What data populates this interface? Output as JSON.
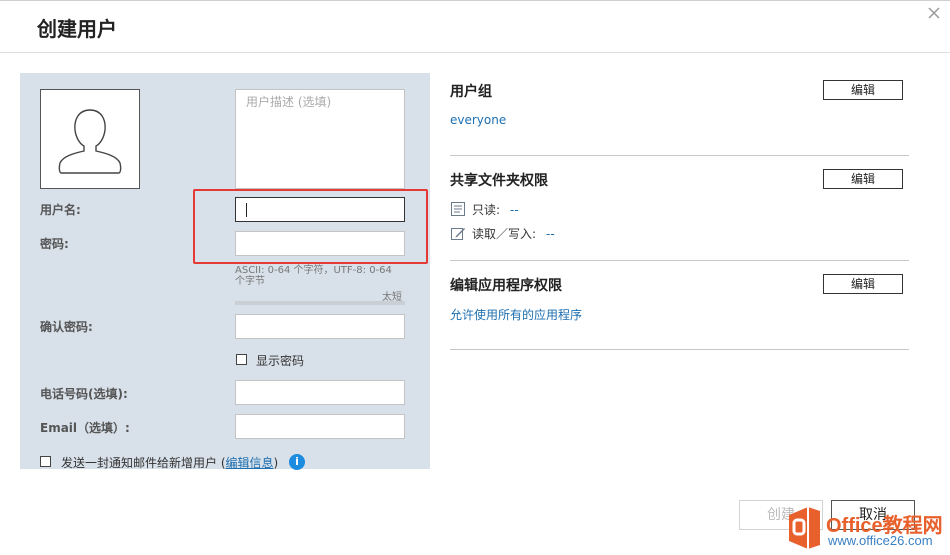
{
  "dialog": {
    "title": "创建用户",
    "close_icon": "close-icon"
  },
  "form": {
    "description_placeholder": "用户描述 (选填)",
    "username_label": "用户名:",
    "password_label": "密码:",
    "password_hint": "ASCII: 0-64 个字符，UTF-8: 0-64 个字节",
    "strength_label": "太短",
    "strength_fraction": 0,
    "confirm_password_label": "确认密码:",
    "show_password_label": "显示密码",
    "show_password_checked": false,
    "phone_label": "电话号码(选填):",
    "email_label": "Email（选填）:",
    "notify_label": "发送一封通知邮件给新增用户 (",
    "notify_link": "编辑信息",
    "notify_close": ")",
    "notify_checked": false,
    "info_icon_glyph": "i"
  },
  "groups": {
    "title": "用户组",
    "edit_label": "编辑",
    "value": "everyone"
  },
  "shared_folders": {
    "title": "共享文件夹权限",
    "edit_label": "编辑",
    "read_only_label": "只读:",
    "read_only_value": "--",
    "read_write_label": "读取／写入:",
    "read_write_value": "--"
  },
  "app_permissions": {
    "title": "编辑应用程序权限",
    "edit_label": "编辑",
    "value": "允许使用所有的应用程序"
  },
  "footer": {
    "create_label": "创建",
    "cancel_label": "取消"
  },
  "watermark": {
    "text": "Office教程网",
    "url": "www.office26.com"
  },
  "colors": {
    "panel_bg": "#d8e1e9",
    "link_blue": "#1e6fb0",
    "highlight_red": "#e53935",
    "watermark_orange": "#e8612c"
  }
}
